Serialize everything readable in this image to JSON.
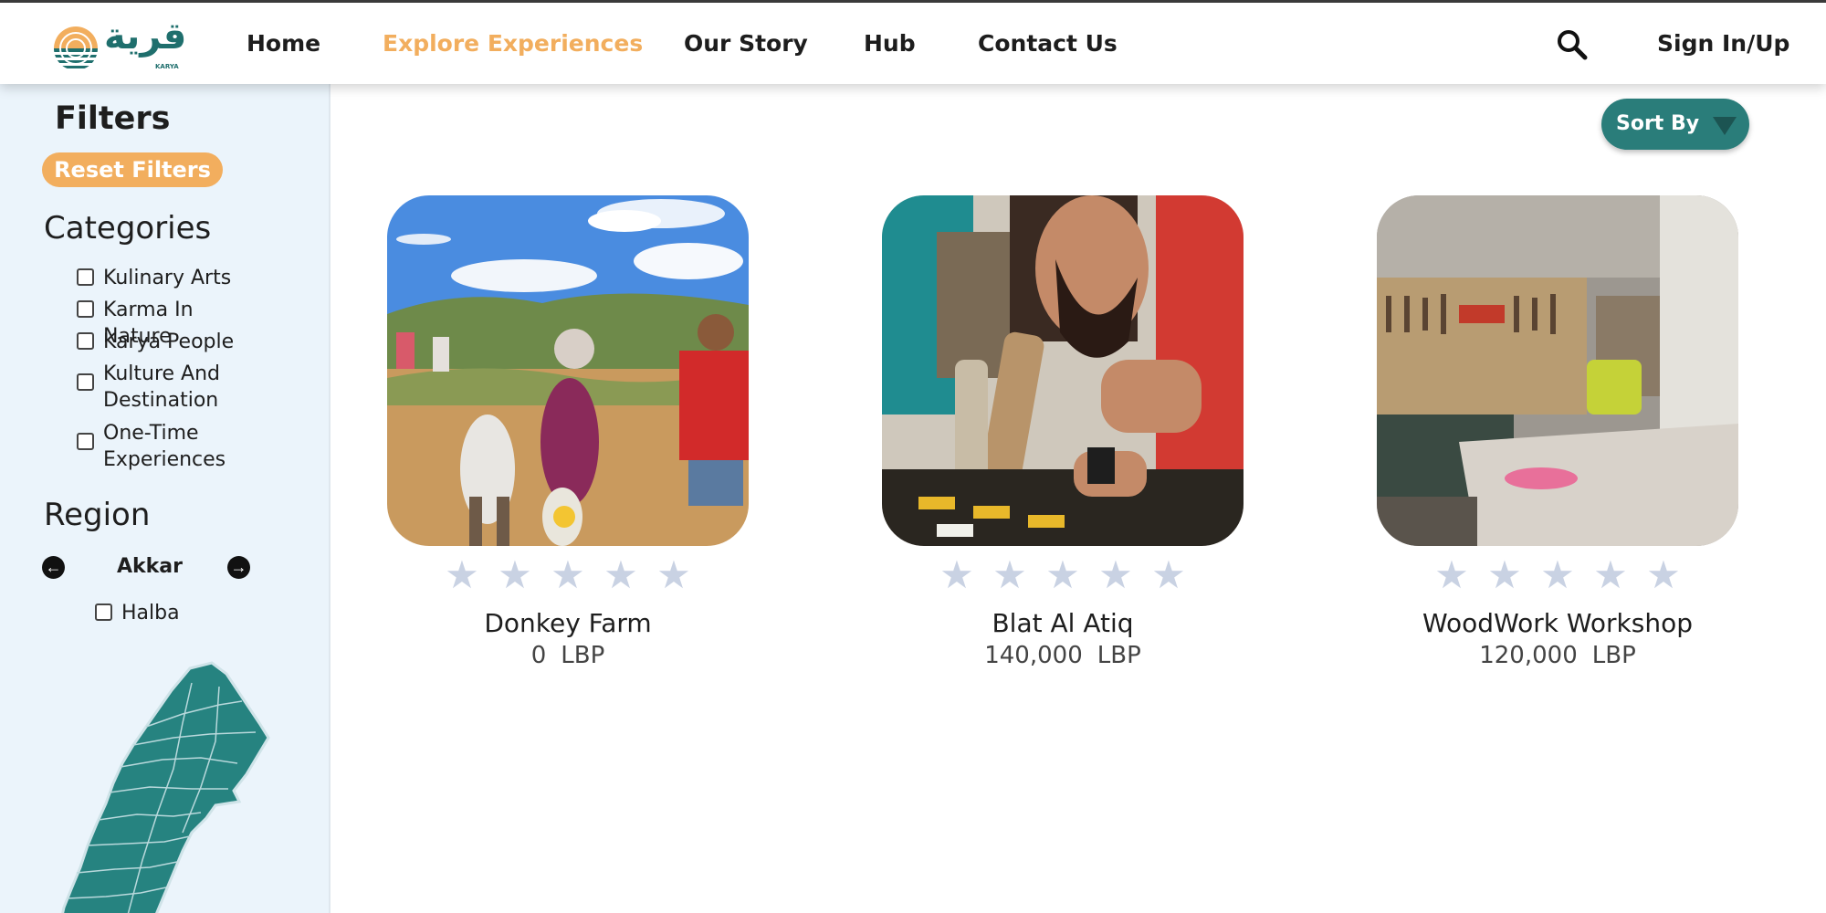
{
  "header": {
    "logo_text": "قرية",
    "logo_subtext": "KARYA",
    "nav": [
      {
        "label": "Home",
        "active": false
      },
      {
        "label": "Explore Experiences",
        "active": true
      },
      {
        "label": "Our Story",
        "active": false
      },
      {
        "label": "Hub",
        "active": false
      },
      {
        "label": "Contact Us",
        "active": false
      }
    ],
    "search_icon": "search-icon",
    "signin_label": "Sign In/Up"
  },
  "sidebar": {
    "filters_title": "Filters",
    "reset_label": "Reset Filters",
    "categories_title": "Categories",
    "categories": [
      {
        "label": "Kulinary Arts",
        "checked": false
      },
      {
        "label": "Karma In Nature",
        "checked": false
      },
      {
        "label": "Karya People",
        "checked": false
      },
      {
        "label": "Kulture And Destination",
        "checked": false
      },
      {
        "label": "One-Time Experiences",
        "checked": false
      }
    ],
    "region_title": "Region",
    "region_selected": "Akkar",
    "subregions": [
      {
        "label": "Halba",
        "checked": false
      }
    ]
  },
  "main": {
    "sort_label": "Sort By",
    "cards": [
      {
        "title": "Donkey Farm",
        "price": "0",
        "currency": "LBP",
        "rating": 0,
        "max_rating": 5
      },
      {
        "title": "Blat Al Atiq",
        "price": "140,000",
        "currency": "LBP",
        "rating": 0,
        "max_rating": 5
      },
      {
        "title": "WoodWork Workshop",
        "price": "120,000",
        "currency": "LBP",
        "rating": 0,
        "max_rating": 5
      }
    ]
  },
  "colors": {
    "accent_orange": "#f2ae5e",
    "brand_teal": "#2a7d7a",
    "sidebar_bg": "#ebf4fb",
    "star_empty": "#c9d2e3"
  }
}
